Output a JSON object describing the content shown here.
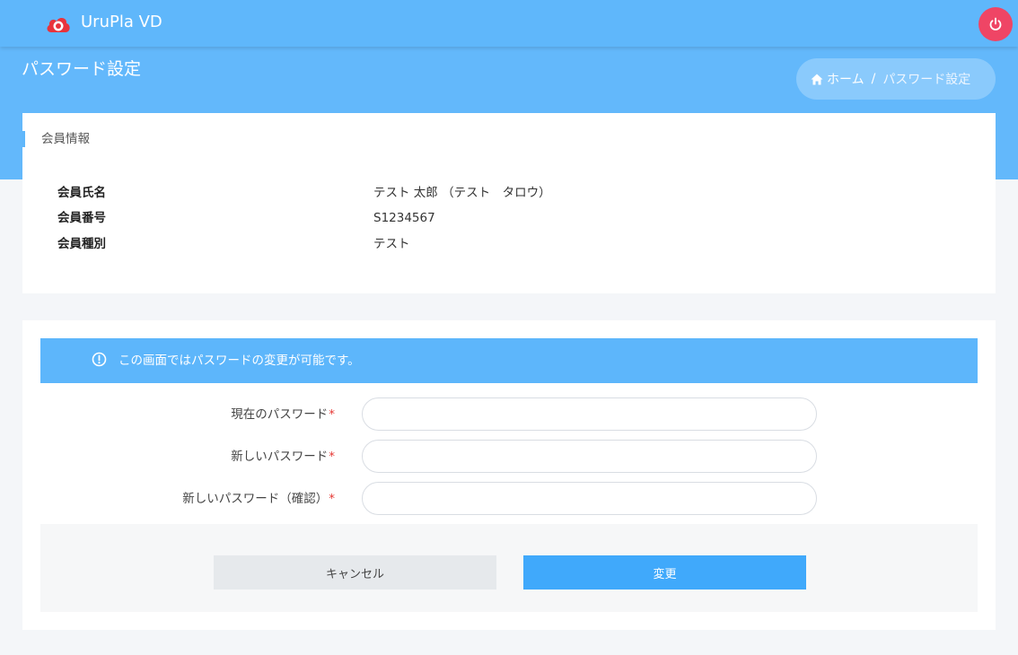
{
  "header": {
    "app_title": "UruPla VD",
    "logo_icon": "cloud-logo-icon",
    "power_icon": "power-icon",
    "brand_color": "#5fb7fb",
    "power_color": "#ef4565"
  },
  "page": {
    "title": "パスワード設定"
  },
  "breadcrumb": {
    "home_label": "ホーム",
    "separator": "/",
    "current": "パスワード設定"
  },
  "member_card": {
    "title": "会員情報",
    "rows": [
      {
        "label": "会員氏名",
        "value": "テスト 太郎 （テスト　タロウ）"
      },
      {
        "label": "会員番号",
        "value": "S1234567"
      },
      {
        "label": "会員種別",
        "value": "テスト"
      }
    ]
  },
  "password_form": {
    "notice": "この画面ではパスワードの変更が可能です。",
    "required_mark": "*",
    "fields": [
      {
        "label": "現在のパスワード",
        "value": "",
        "placeholder": ""
      },
      {
        "label": "新しいパスワード",
        "value": "",
        "placeholder": ""
      },
      {
        "label": "新しいパスワード（確認）",
        "value": "",
        "placeholder": ""
      }
    ],
    "cancel_label": "キャンセル",
    "submit_label": "変更"
  }
}
